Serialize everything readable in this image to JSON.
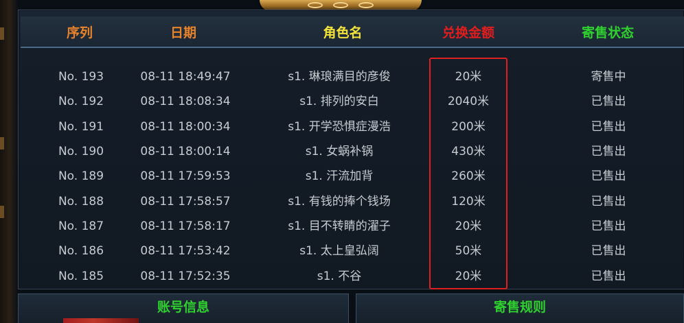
{
  "header": {
    "col_index": "序列",
    "col_date": "日期",
    "col_role": "角色名",
    "col_amount": "兑换金额",
    "col_status": "寄售状态"
  },
  "colors": {
    "header_orange": "#e8832a",
    "header_yellow": "#f2e23a",
    "header_red": "#e11d1d",
    "header_green": "#2fd12f",
    "row_text": "#c8ccd2",
    "highlight_border": "#e0201e"
  },
  "records": [
    {
      "index": "No. 193",
      "date": "08-11  18:49:47",
      "role": "s1. 琳琅满目的彦俊",
      "amount": "20米",
      "status": "寄售中"
    },
    {
      "index": "No. 192",
      "date": "08-11  18:08:34",
      "role": "s1. 排列的安白",
      "amount": "2040米",
      "status": "已售出"
    },
    {
      "index": "No. 191",
      "date": "08-11  18:00:34",
      "role": "s1. 开学恐惧症漫浩",
      "amount": "200米",
      "status": "已售出"
    },
    {
      "index": "No. 190",
      "date": "08-11  18:00:14",
      "role": "s1. 女蜗补锅",
      "amount": "430米",
      "status": "已售出"
    },
    {
      "index": "No. 189",
      "date": "08-11  17:59:53",
      "role": "s1. 汗流加背",
      "amount": "260米",
      "status": "已售出"
    },
    {
      "index": "No. 188",
      "date": "08-11  17:58:57",
      "role": "s1. 有钱的捧个钱场",
      "amount": "120米",
      "status": "已售出"
    },
    {
      "index": "No. 187",
      "date": "08-11  17:58:17",
      "role": "s1. 目不转睛的濯子",
      "amount": "20米",
      "status": "已售出"
    },
    {
      "index": "No. 186",
      "date": "08-11  17:53:42",
      "role": "s1. 太上皇弘阔",
      "amount": "50米",
      "status": "已售出"
    },
    {
      "index": "No. 185",
      "date": "08-11  17:52:35",
      "role": "s1. 不谷",
      "amount": "20米",
      "status": "已售出"
    }
  ],
  "tabs": {
    "account_info": "账号信息",
    "consign_rules": "寄售规则"
  }
}
